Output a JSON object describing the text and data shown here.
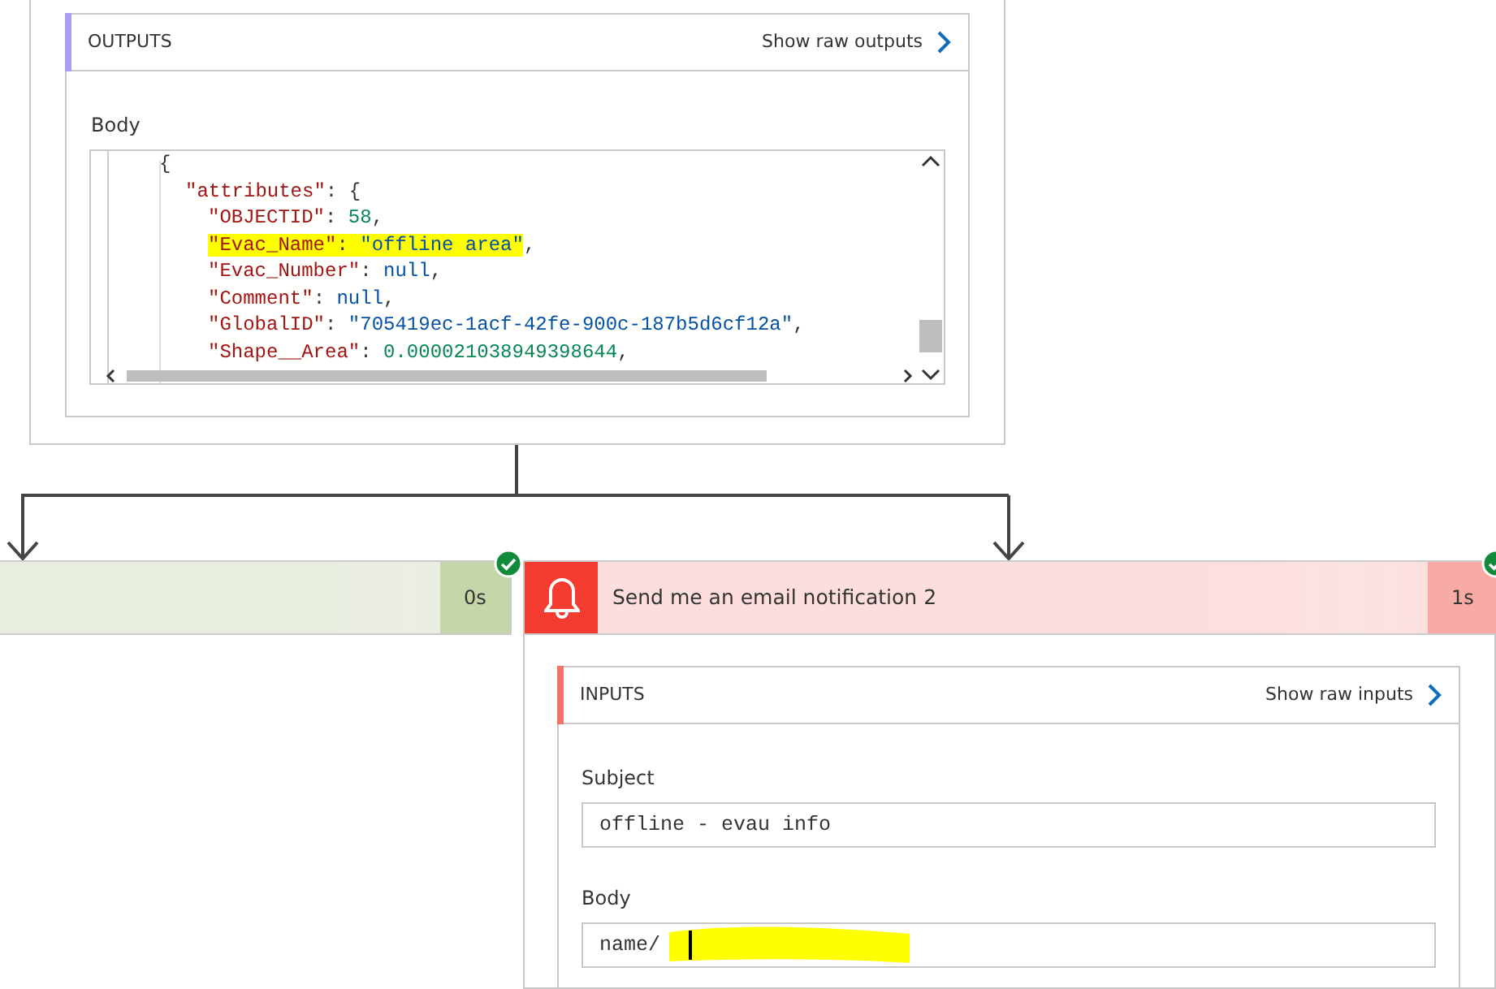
{
  "outputs_card": {
    "header": {
      "title": "OUTPUTS",
      "link": "Show raw outputs"
    },
    "body_label": "Body",
    "code_lines": [
      {
        "kind": "brace",
        "tokens": [
          {
            "kind": "punct",
            "t": "{"
          }
        ]
      },
      {
        "kind": "object-open",
        "tokens": [
          {
            "kind": "key",
            "t": "\"attributes\""
          },
          {
            "kind": "punct",
            "t": ": {"
          }
        ]
      },
      {
        "kind": "property",
        "tokens": [
          {
            "kind": "key",
            "t": "\"OBJECTID\""
          },
          {
            "kind": "punct",
            "t": ": "
          },
          {
            "kind": "number",
            "t": "58"
          },
          {
            "kind": "punct",
            "t": ","
          }
        ]
      },
      {
        "kind": "property",
        "highlighted": true,
        "tokens": [
          {
            "kind": "key",
            "t": "\"Evac_Name\""
          },
          {
            "kind": "punct",
            "t": ": "
          },
          {
            "kind": "string",
            "t": "\"offline area\""
          },
          {
            "kind": "punct",
            "t": ","
          }
        ]
      },
      {
        "kind": "property",
        "tokens": [
          {
            "kind": "key",
            "t": "\"Evac_Number\""
          },
          {
            "kind": "punct",
            "t": ": "
          },
          {
            "kind": "keyword",
            "t": "null"
          },
          {
            "kind": "punct",
            "t": ","
          }
        ]
      },
      {
        "kind": "property",
        "tokens": [
          {
            "kind": "key",
            "t": "\"Comment\""
          },
          {
            "kind": "punct",
            "t": ": "
          },
          {
            "kind": "keyword",
            "t": "null"
          },
          {
            "kind": "punct",
            "t": ","
          }
        ]
      },
      {
        "kind": "property",
        "tokens": [
          {
            "kind": "key",
            "t": "\"GlobalID\""
          },
          {
            "kind": "punct",
            "t": ": "
          },
          {
            "kind": "string",
            "t": "\"705419ec-1acf-42fe-900c-187b5d6cf12a\""
          },
          {
            "kind": "punct",
            "t": ","
          }
        ]
      },
      {
        "kind": "property",
        "tokens": [
          {
            "kind": "key",
            "t": "\"Shape__Area\""
          },
          {
            "kind": "punct",
            "t": ": "
          },
          {
            "kind": "number",
            "t": "0.000021038949398644"
          },
          {
            "kind": "punct",
            "t": ","
          }
        ]
      }
    ]
  },
  "steps": [
    {
      "kind": "condition",
      "duration": "0s",
      "succeeded": true
    },
    {
      "kind": "notification",
      "title": "Send me an email notification 2",
      "duration": "1s",
      "succeeded": true
    }
  ],
  "inputs_card": {
    "header": {
      "title": "INPUTS",
      "link": "Show raw inputs"
    },
    "fields": [
      {
        "label": "Subject",
        "value": "offline - evau info",
        "redacted": false
      },
      {
        "label": "Body",
        "value": "name/ ",
        "redacted": true
      }
    ]
  }
}
